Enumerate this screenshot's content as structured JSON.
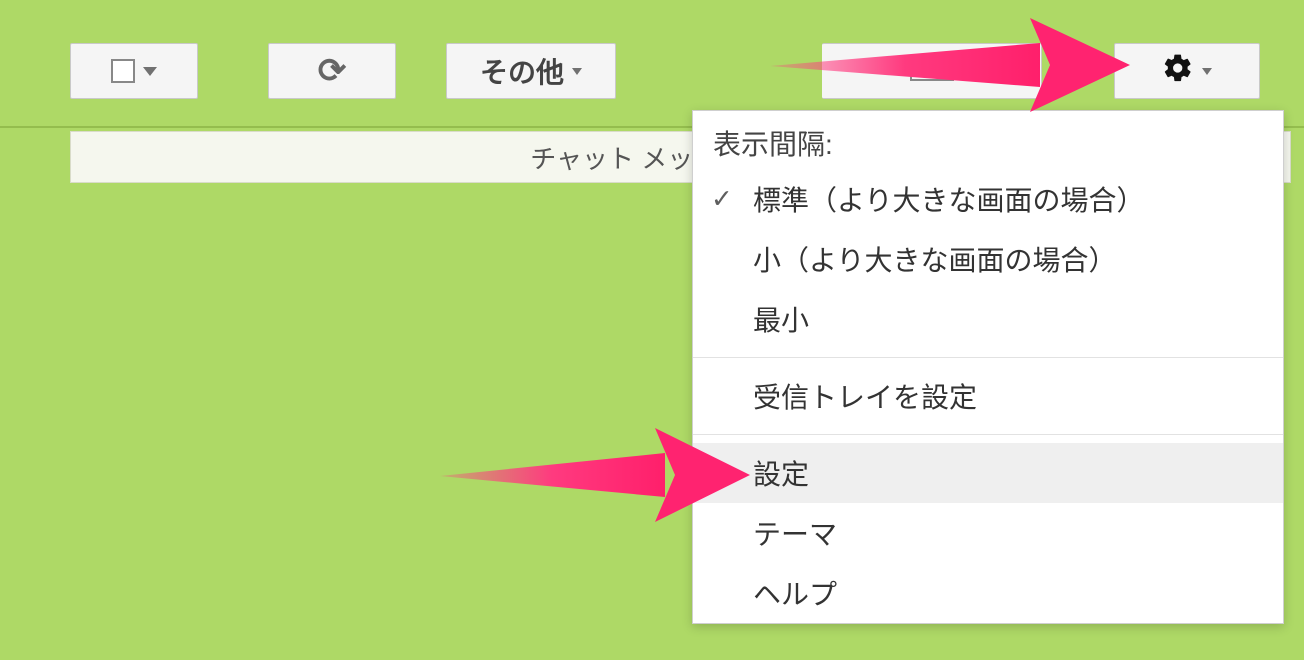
{
  "toolbar": {
    "more_label": "その他"
  },
  "banner": {
    "text": "チャット メッセージ"
  },
  "dropdown": {
    "header": "表示間隔:",
    "density": {
      "standard": "標準（より大きな画面の場合）",
      "small": "小（より大きな画面の場合）",
      "minimal": "最小"
    },
    "configure_inbox": "受信トレイを設定",
    "settings": "設定",
    "theme": "テーマ",
    "help": "ヘルプ"
  },
  "colors": {
    "background": "#aed966",
    "arrow": "#ff3a7f"
  }
}
